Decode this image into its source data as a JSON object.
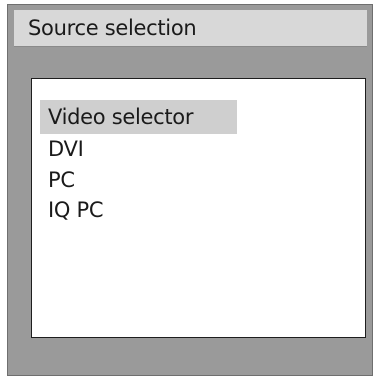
{
  "window": {
    "title": "Source selection"
  },
  "source_list": {
    "items": [
      {
        "label": "Video selector",
        "selected": true
      },
      {
        "label": "DVI",
        "selected": false
      },
      {
        "label": "PC",
        "selected": false
      },
      {
        "label": "IQ PC",
        "selected": false
      }
    ]
  },
  "colors": {
    "panel_background": "#9a9a9a",
    "title_background": "#d8d8d8",
    "list_background": "#ffffff",
    "selection_highlight": "#cfcfcf"
  }
}
